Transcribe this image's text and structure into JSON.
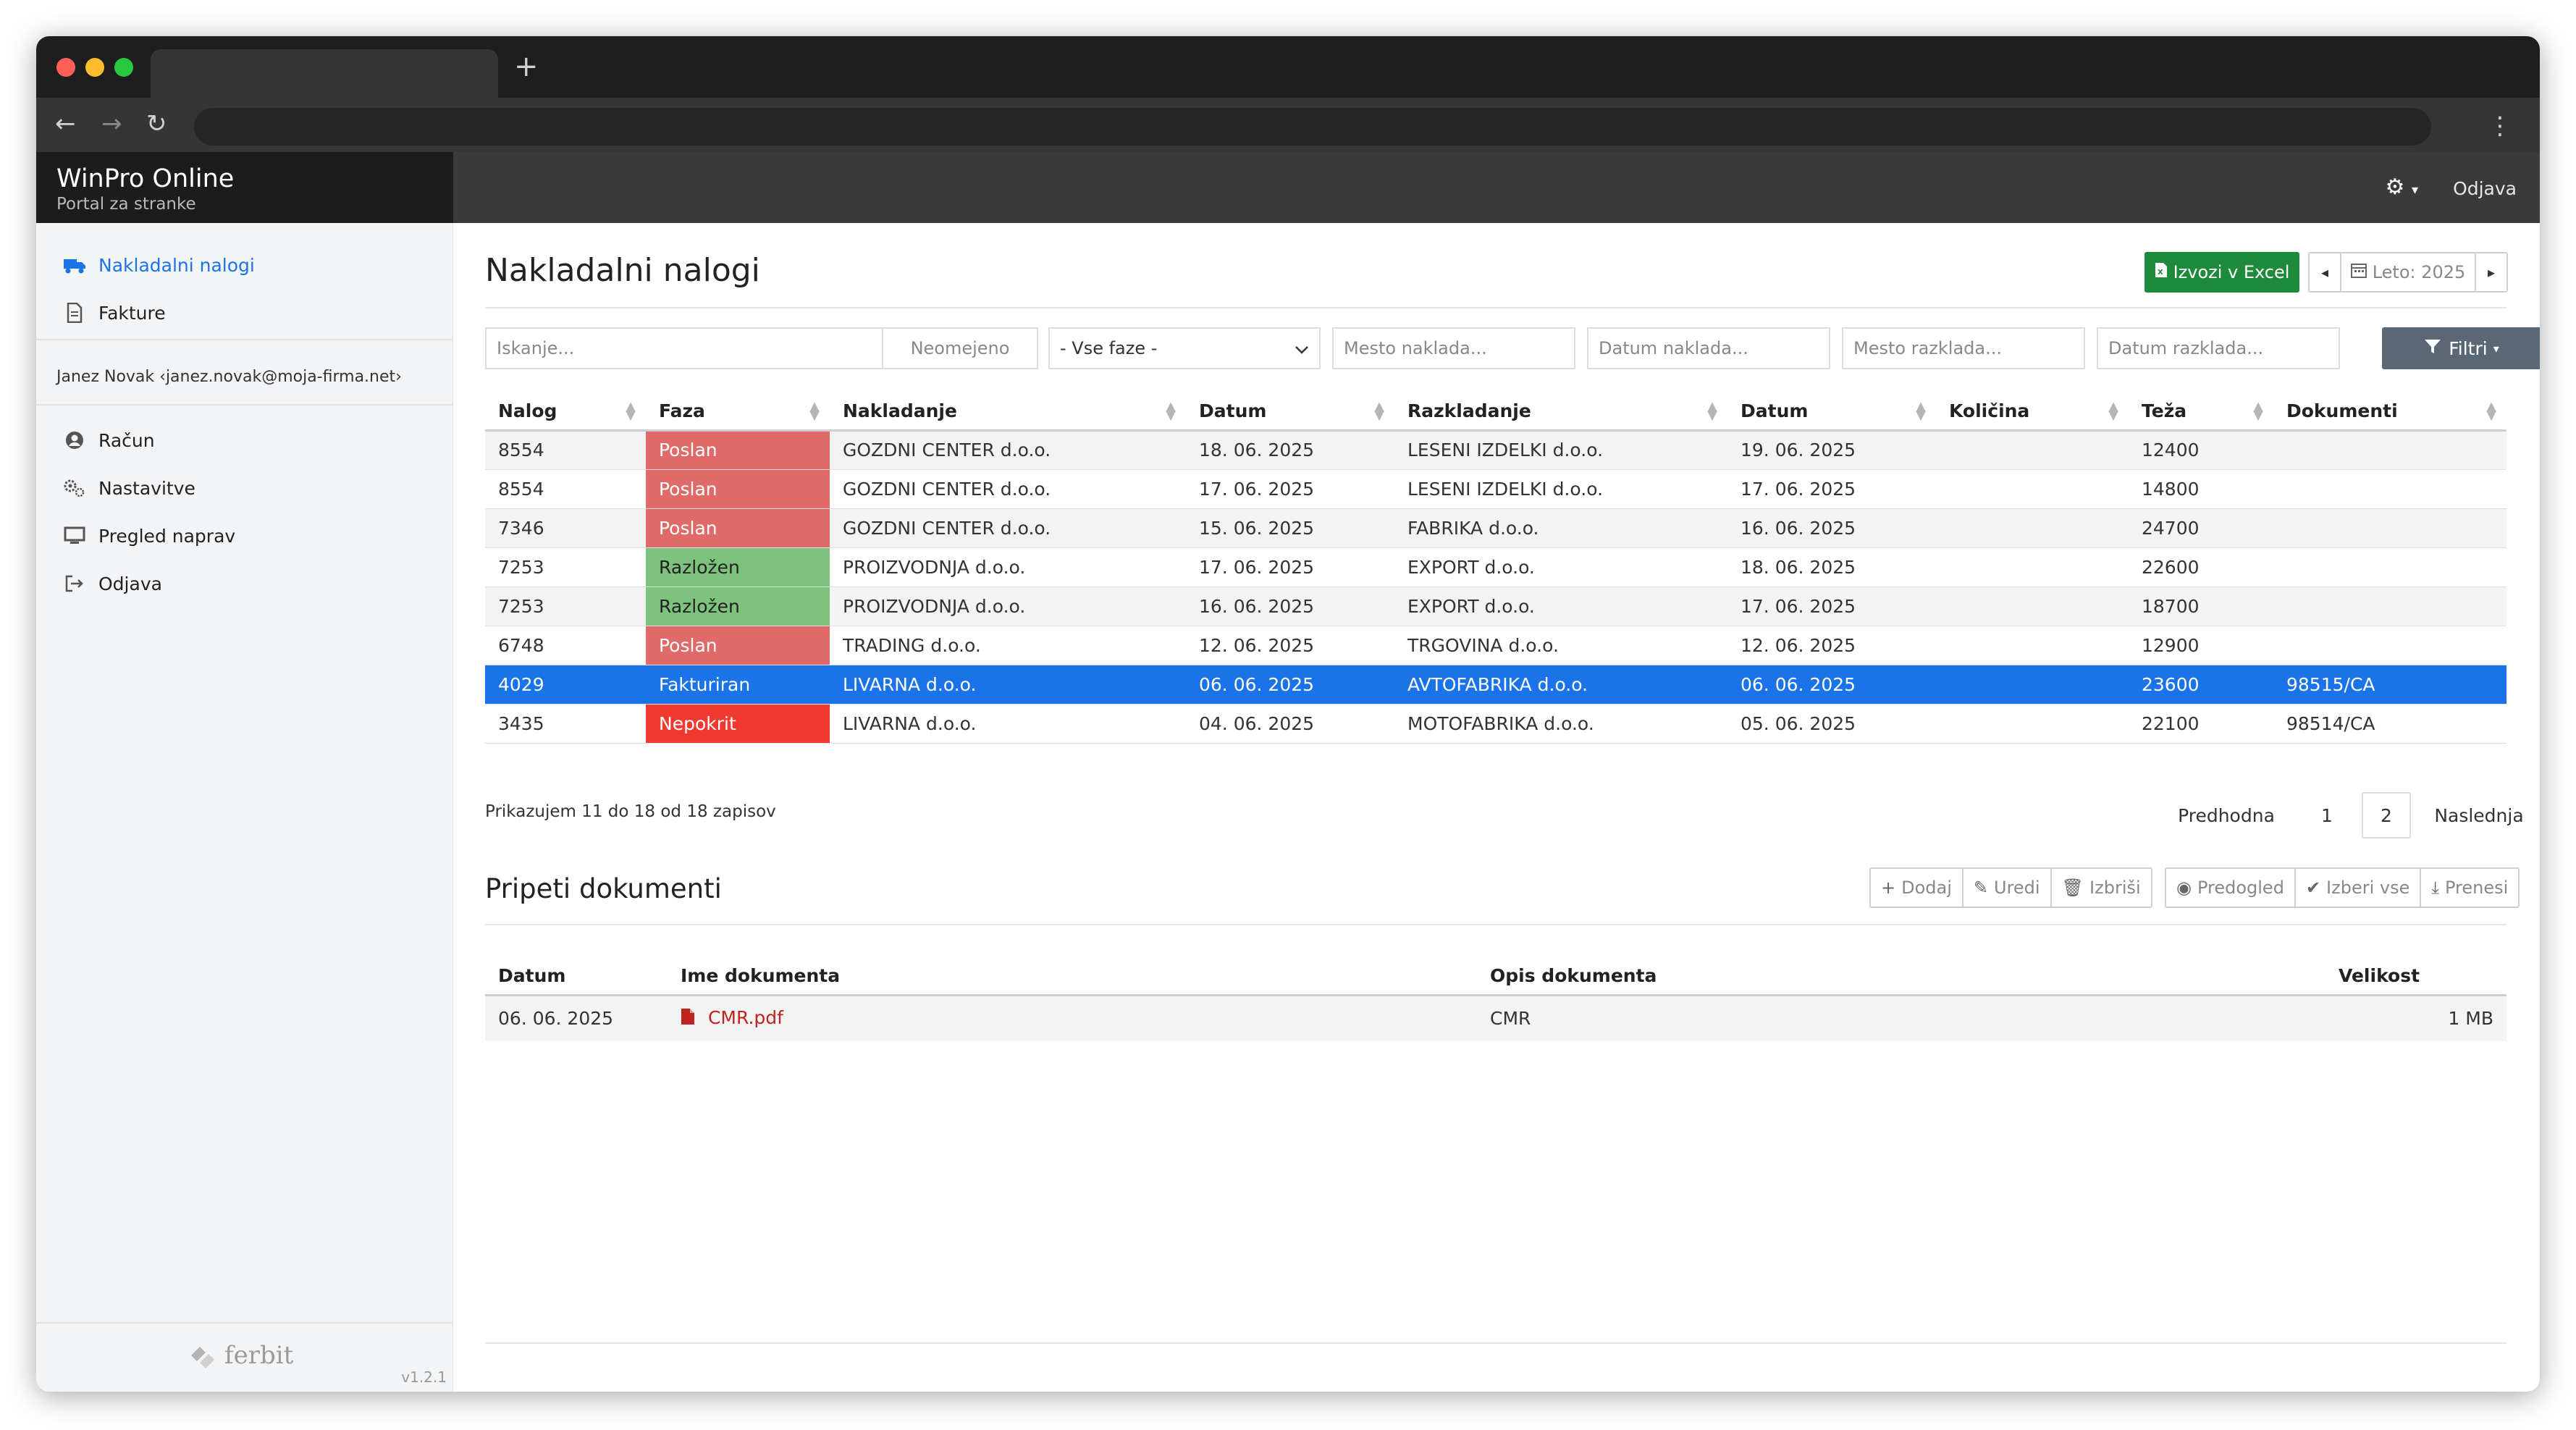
{
  "app": {
    "title": "WinPro Online",
    "subtitle": "Portal za stranke",
    "logout": "Odjava"
  },
  "sidebar": {
    "items": [
      {
        "label": "Nakladalni nalogi",
        "icon": "truck-icon",
        "active": true
      },
      {
        "label": "Fakture",
        "icon": "document-icon"
      }
    ],
    "user": "Janez Novak ‹janez.novak@moja-firma.net›",
    "account_items": [
      {
        "label": "Račun",
        "icon": "user-circle-icon"
      },
      {
        "label": "Nastavitve",
        "icon": "gears-icon"
      },
      {
        "label": "Pregled naprav",
        "icon": "monitor-icon"
      },
      {
        "label": "Odjava",
        "icon": "sign-out-icon"
      }
    ],
    "footer_logo": "ferbit",
    "version": "v1.2.1"
  },
  "page": {
    "title": "Nakladalni nalogi",
    "export_label": "Izvozi v Excel",
    "year_label": "Leto: 2025"
  },
  "filters": {
    "search": "Iskanje...",
    "limit": "Neomejeno",
    "phase": "- Vse faze -",
    "load_place": "Mesto naklada...",
    "load_date": "Datum naklada...",
    "unload_place": "Mesto razklada...",
    "unload_date": "Datum razklada...",
    "filter_button": "Filtri"
  },
  "table": {
    "columns": [
      "Nalog",
      "Faza",
      "Nakladanje",
      "Datum",
      "Razkladanje",
      "Datum",
      "Količina",
      "Teža",
      "Dokumenti"
    ],
    "rows": [
      [
        "8554",
        "Poslan",
        "GOZDNI CENTER d.o.o.",
        "18. 06. 2025",
        "LESENI IZDELKI d.o.o.",
        "19. 06. 2025",
        "",
        "12400",
        ""
      ],
      [
        "8554",
        "Poslan",
        "GOZDNI CENTER d.o.o.",
        "17. 06. 2025",
        "LESENI IZDELKI d.o.o.",
        "17. 06. 2025",
        "",
        "14800",
        ""
      ],
      [
        "7346",
        "Poslan",
        "GOZDNI CENTER d.o.o.",
        "15. 06. 2025",
        "FABRIKA d.o.o.",
        "16. 06. 2025",
        "",
        "24700",
        ""
      ],
      [
        "7253",
        "Razložen",
        "PROIZVODNJA d.o.o.",
        "17. 06. 2025",
        "EXPORT d.o.o.",
        "18. 06. 2025",
        "",
        "22600",
        ""
      ],
      [
        "7253",
        "Razložen",
        "PROIZVODNJA d.o.o.",
        "16. 06. 2025",
        "EXPORT d.o.o.",
        "17. 06. 2025",
        "",
        "18700",
        ""
      ],
      [
        "6748",
        "Poslan",
        "TRADING d.o.o.",
        "12. 06. 2025",
        "TRGOVINA d.o.o.",
        "12. 06. 2025",
        "",
        "12900",
        ""
      ],
      [
        "4029",
        "Fakturiran",
        "LIVARNA d.o.o.",
        "06. 06. 2025",
        "AVTOFABRIKA d.o.o.",
        "06. 06. 2025",
        "",
        "23600",
        "98515/CA"
      ],
      [
        "3435",
        "Nepokrit",
        "LIVARNA d.o.o.",
        "04. 06. 2025",
        "MOTOFABRIKA d.o.o.",
        "05. 06. 2025",
        "",
        "22100",
        "98514/CA"
      ]
    ],
    "selected_row": 6,
    "info": "Prikazujem 11 do 18 od 18 zapisov",
    "pagination": {
      "prev": "Predhodna",
      "pages": [
        "1",
        "2"
      ],
      "current": "2",
      "next": "Naslednja"
    }
  },
  "attachments": {
    "title": "Pripeti dokumenti",
    "buttons": {
      "add": "Dodaj",
      "edit": "Uredi",
      "delete": "Izbriši",
      "preview": "Predogled",
      "select_all": "Izberi vse",
      "download": "Prenesi"
    },
    "columns": [
      "Datum",
      "Ime dokumenta",
      "Opis dokumenta",
      "Velikost"
    ],
    "rows": [
      [
        "06. 06. 2025",
        "CMR.pdf",
        "CMR",
        "1 MB"
      ]
    ]
  },
  "colors": {
    "accent": "#1a73e8",
    "excel": "#1e8a3c",
    "poslan": "#e06a6a",
    "razlozen": "#7dc27d",
    "nepokrit": "#f03a30",
    "filter_btn": "#5a6774"
  }
}
